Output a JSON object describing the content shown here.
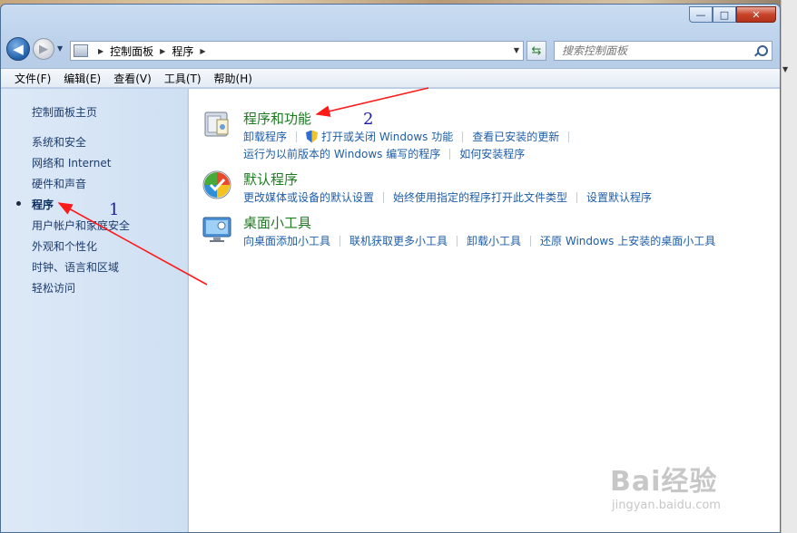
{
  "window": {
    "minimize_glyph": "—",
    "maximize_glyph": "□",
    "close_glyph": "✕"
  },
  "address": {
    "crumbs": [
      "控制面板",
      "程序"
    ]
  },
  "search": {
    "placeholder": "搜索控制面板"
  },
  "menu": [
    "文件(F)",
    "编辑(E)",
    "查看(V)",
    "工具(T)",
    "帮助(H)"
  ],
  "sidebar": {
    "home": "控制面板主页",
    "items": [
      {
        "label": "系统和安全"
      },
      {
        "label": "网络和 Internet"
      },
      {
        "label": "硬件和声音"
      },
      {
        "label": "程序",
        "current": true
      },
      {
        "label": "用户帐户和家庭安全"
      },
      {
        "label": "外观和个性化"
      },
      {
        "label": "时钟、语言和区域"
      },
      {
        "label": "轻松访问"
      }
    ]
  },
  "categories": [
    {
      "title": "程序和功能",
      "icon": "programs-icon",
      "lines": [
        [
          "卸载程序",
          "打开或关闭 Windows 功能",
          "查看已安装的更新"
        ],
        [
          "运行为以前版本的 Windows 编写的程序",
          "如何安装程序"
        ]
      ]
    },
    {
      "title": "默认程序",
      "icon": "default-programs-icon",
      "lines": [
        [
          "更改媒体或设备的默认设置",
          "始终使用指定的程序打开此文件类型",
          "设置默认程序"
        ]
      ]
    },
    {
      "title": "桌面小工具",
      "icon": "gadgets-icon",
      "lines": [
        [
          "向桌面添加小工具",
          "联机获取更多小工具",
          "卸载小工具",
          "还原 Windows 上安装的桌面小工具"
        ]
      ]
    }
  ],
  "annotations": {
    "label1": "1",
    "label2": "2",
    "arrow_color": "#ff1a1a"
  },
  "watermark": {
    "main": "Bai经验",
    "sub": "jingyan.baidu.com"
  },
  "colors": {
    "link": "#1e5da8",
    "category_title": "#1e7b22",
    "sidebar_bg": "#d6e5f6"
  }
}
